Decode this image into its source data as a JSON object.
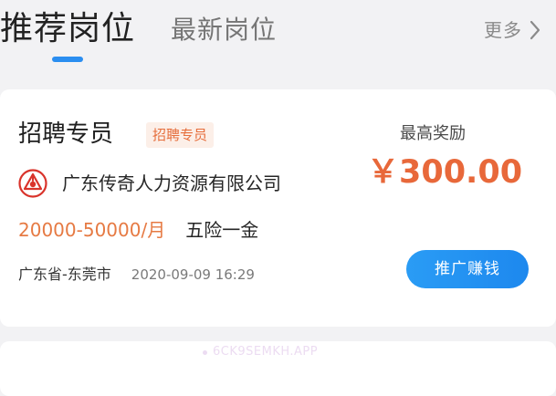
{
  "tabs": {
    "active_label": "推荐岗位",
    "inactive_label": "最新岗位",
    "more_label": "更多"
  },
  "job": {
    "title": "招聘专员",
    "tag": "招聘专员",
    "company": "广东传奇人力资源有限公司",
    "salary": "20000-50000/月",
    "benefits": "五险一金",
    "location": "广东省-东莞市",
    "posted_time": "2020-09-09 16:29",
    "reward_label": "最高奖励",
    "reward_amount": "￥300.00",
    "promote_button_label": "推广赚钱"
  },
  "watermark": {
    "text": "6CK9SEMKH.APP"
  },
  "icons": {
    "more": "chevron-right-icon",
    "company_logo": "company-logo-icon"
  },
  "colors": {
    "accent_blue": "#2b8ef0",
    "reward_orange": "#e8683a",
    "salary_orange": "#e67a43",
    "tag_background": "#fcefe8",
    "logo_red": "#d9332b"
  }
}
